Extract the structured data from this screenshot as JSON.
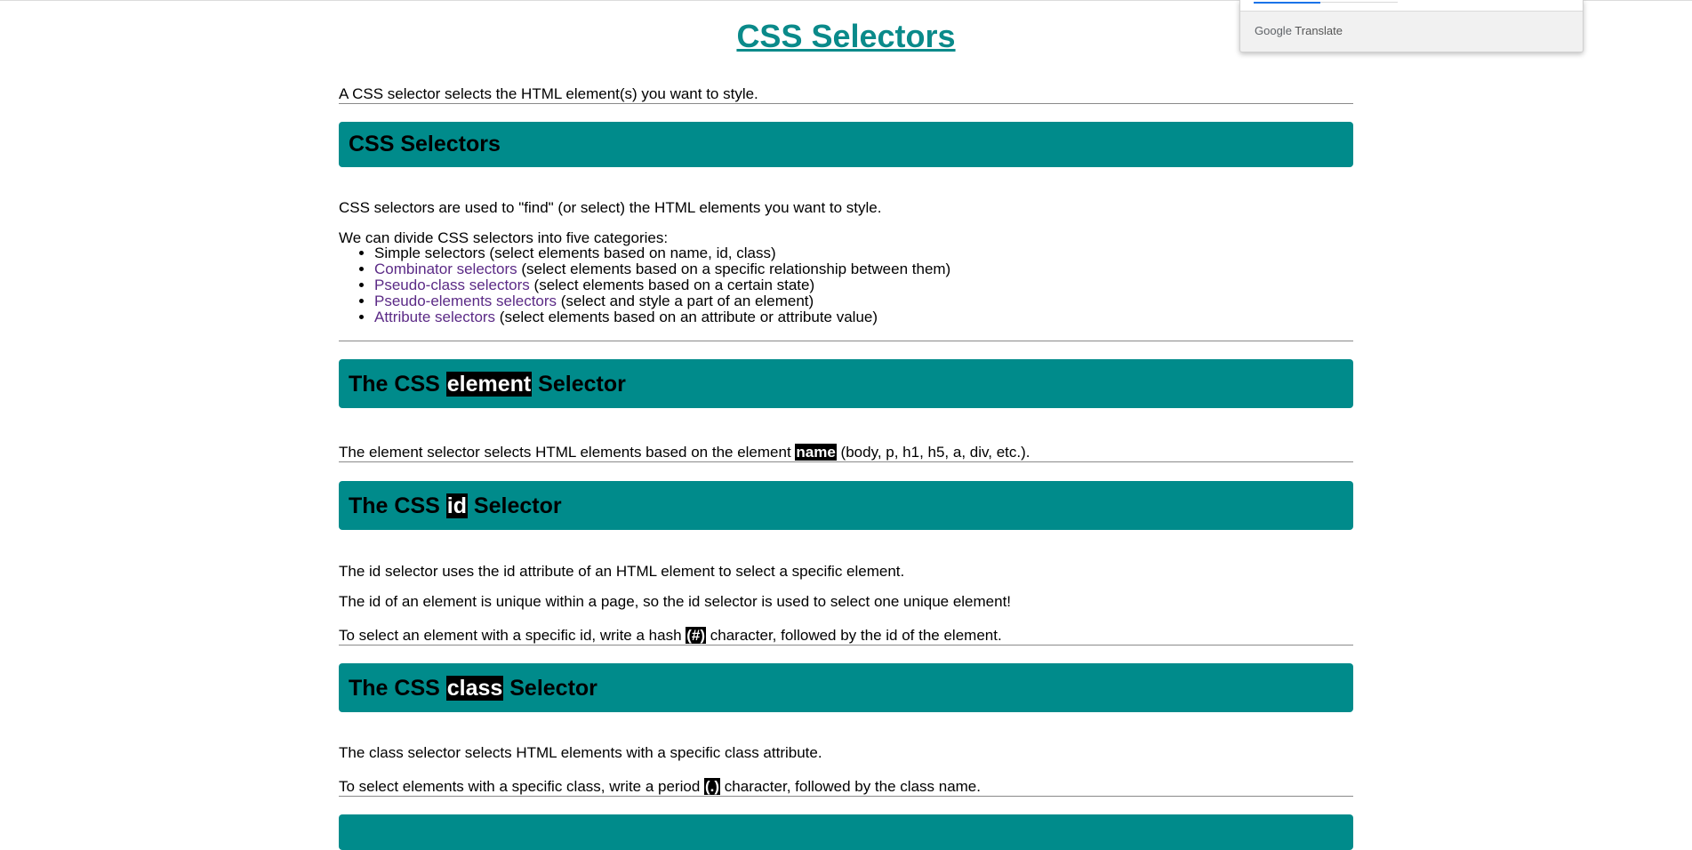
{
  "page_title": "CSS Selectors",
  "intro": "A CSS selector selects the HTML element(s) you want to style.",
  "sections": [
    {
      "heading": "CSS Selectors",
      "paragraphs": [
        "CSS selectors are used to \"find\" (or select) the HTML elements you want to style.",
        "We can divide CSS selectors into five categories:"
      ],
      "categories": [
        {
          "link": "",
          "text": "Simple selectors (select elements based on name, id, class)"
        },
        {
          "link": "Combinator selectors",
          "text": " (select elements based on a specific relationship between them)"
        },
        {
          "link": "Pseudo-class selectors",
          "text": " (select elements based on a certain state)"
        },
        {
          "link": "Pseudo-elements selectors",
          "text": " (select and style a part of an element)"
        },
        {
          "link": "Attribute selectors",
          "text": " (select elements based on an attribute or attribute value)"
        }
      ]
    },
    {
      "heading_pre": "The CSS ",
      "heading_hl": "element",
      "heading_post": " Selector",
      "p1_pre": "The element selector selects HTML elements based on the element ",
      "p1_hl": "name",
      "p1_post": " (body, p, h1, h5, a, div, etc.)."
    },
    {
      "heading_pre": "The CSS ",
      "heading_hl": "id",
      "heading_post": " Selector",
      "p1": "The id selector uses the id attribute of an HTML element to select a specific element.",
      "p2": "The id of an element is unique within a page, so the id selector is used to select one unique element!",
      "p3_pre": "To select an element with a specific id, write a hash ",
      "p3_hl": "(#)",
      "p3_post": " character, followed by the id of the element."
    },
    {
      "heading_pre": "The CSS ",
      "heading_hl": "class",
      "heading_post": " Selector",
      "p1": "The class selector selects HTML elements with a specific class attribute.",
      "p2_pre": "To select elements with a specific class, write a period ",
      "p2_hl": "(.)",
      "p2_post": " character, followed by the class name."
    }
  ],
  "translate_popup": {
    "brand_google": "Google",
    "brand_translate": " Translate"
  },
  "colors": {
    "band": "#008b8b",
    "title": "#0a8a8a",
    "link": "#5b2a86"
  }
}
